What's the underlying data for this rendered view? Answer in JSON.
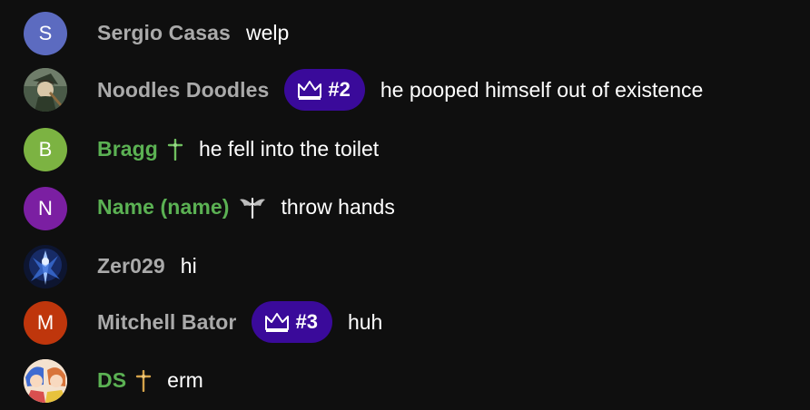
{
  "messages": [
    {
      "author": "Sergio Casas",
      "author_color": "#aaaaaa",
      "avatar": {
        "type": "letter",
        "letter": "S",
        "color": "#5c6bc0"
      },
      "text": "welp"
    },
    {
      "author": "Noodles Doodles",
      "author_color": "#aaaaaa",
      "avatar": {
        "type": "image",
        "icon": "anime-character-avatar"
      },
      "rank_badge": {
        "icon": "crown-icon",
        "label": "#2"
      },
      "text": "he pooped himself out of existence"
    },
    {
      "author": "Bragg",
      "author_color": "#5bb153",
      "avatar": {
        "type": "letter",
        "letter": "B",
        "color": "#7cb342"
      },
      "member_badge": "cross-badge-icon",
      "text": "he fell into the toilet"
    },
    {
      "author": "Name (name)",
      "author_color": "#5bb153",
      "avatar": {
        "type": "letter",
        "letter": "N",
        "color": "#7b1fa2"
      },
      "member_badge": "winged-cross-badge-icon",
      "text": "throw hands"
    },
    {
      "author": "Zer029",
      "author_color": "#aaaaaa",
      "avatar": {
        "type": "image",
        "icon": "blue-character-avatar"
      },
      "text": "hi"
    },
    {
      "author": "Mitchell Bator",
      "author_color": "#aaaaaa",
      "avatar": {
        "type": "letter",
        "letter": "M",
        "color": "#bf360c"
      },
      "rank_badge": {
        "icon": "crown-icon",
        "label": "#3"
      },
      "text": "huh"
    },
    {
      "author": "DS",
      "author_color": "#5bb153",
      "avatar": {
        "type": "image",
        "icon": "anime-duo-avatar"
      },
      "member_badge": "gold-cross-badge-icon",
      "text": "erm"
    }
  ],
  "colors": {
    "background": "#0f0f0f",
    "rank_pill": "#3a0a9a",
    "member_name": "#5bb153",
    "regular_name": "#aaaaaa"
  }
}
